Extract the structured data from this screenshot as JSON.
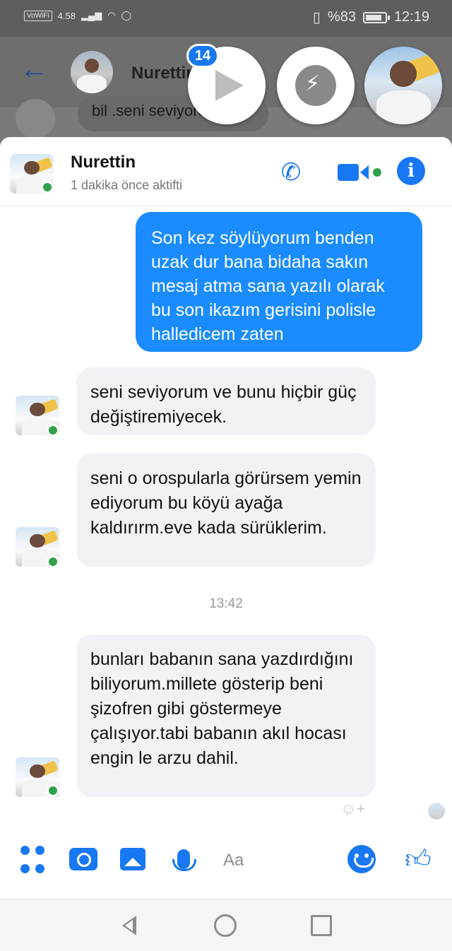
{
  "status_bar": {
    "left_label": "VoWiFi",
    "network_speed": "4.58",
    "battery_percent": "%83",
    "time": "12:19"
  },
  "background_chat": {
    "contact_name": "Nurettin",
    "peek_message": "bil .seni seviyorum."
  },
  "chat_heads": {
    "unread_count": "14"
  },
  "header": {
    "contact_name": "Nurettin",
    "status": "1 dakika önce aktifti"
  },
  "messages": [
    {
      "direction": "outgoing",
      "text": "Son kez söylüyorum benden uzak dur bana bidaha sakın mesaj atma sana yazılı olarak bu son ikazım gerisini polisle halledicem zaten"
    },
    {
      "direction": "incoming",
      "text": "seni seviyorum ve bunu hiçbir güç değiştiremiyecek."
    },
    {
      "direction": "incoming",
      "text": "seni o orospularla görürsem yemin ediyorum bu köyü ayağa kaldırırm.eve kada sürüklerim."
    },
    {
      "direction": "incoming",
      "text": "bunları babanın sana yazdırdığını biliyorum.millete gösterip beni şizofren gibi göstermeye çalışıyor.tabi babanın akıl hocası engin le arzu dahil."
    }
  ],
  "timestamp": "13:42",
  "composer": {
    "placeholder": "Aa"
  },
  "colors": {
    "accent": "#1877f2",
    "outgoing_bubble": "#1a8cff",
    "incoming_bubble": "#f1f2f6",
    "online": "#31a24c"
  },
  "icons": [
    "back-arrow-icon",
    "play-icon",
    "messenger-icon",
    "phone-icon",
    "video-camera-icon",
    "info-icon",
    "apps-grid-icon",
    "camera-icon",
    "gallery-icon",
    "microphone-icon",
    "emoji-icon",
    "thumbs-up-icon",
    "add-reaction-icon",
    "nav-back-icon",
    "nav-home-icon",
    "nav-recents-icon"
  ]
}
